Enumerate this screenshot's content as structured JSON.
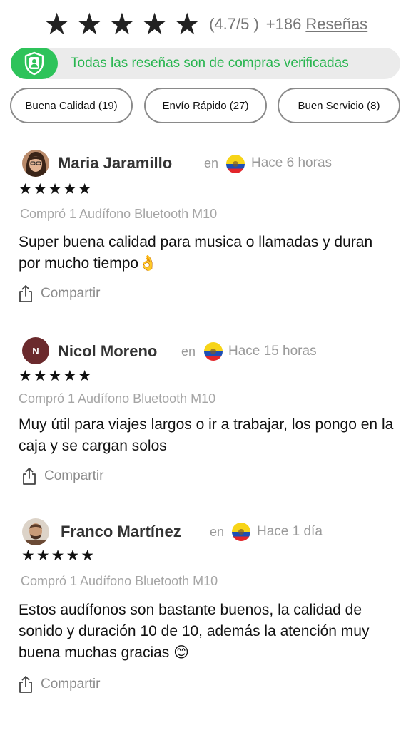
{
  "summary": {
    "stars": "★★★★★",
    "rating": "(4.7/5 )",
    "count": "+186",
    "reviews_link": "Reseñas"
  },
  "verified": {
    "icon": "shield-user-icon",
    "text": "Todas las reseñas son de compras verificadas",
    "color": "#28b54f"
  },
  "filters": [
    {
      "label": "Buena Calidad (19)"
    },
    {
      "label": "Envío Rápido (27)"
    },
    {
      "label": "Buen Servicio (8)"
    }
  ],
  "reviews": [
    {
      "name": "Maria Jaramillo",
      "en": "en",
      "time": "Hace 6 horas",
      "stars": "★★★★★",
      "purchase": "Compró 1 Audífono Bluetooth M10",
      "text": "Super buena calidad para musica o llamadas y duran por mucho tiempo👌",
      "share": "Compartir"
    },
    {
      "name": "Nicol Moreno",
      "initial": "N",
      "en": "en",
      "time": "Hace 15 horas",
      "stars": "★★★★★",
      "purchase": "Compró 1 Audífono Bluetooth M10",
      "text": "Muy útil para viajes largos o ir a trabajar, los pongo en la caja y se cargan solos",
      "share": "Compartir"
    },
    {
      "name": "Franco Martínez",
      "en": "en",
      "time": "Hace 1 día",
      "stars": "★★★★★",
      "purchase": "Compró 1 Audífono Bluetooth M10",
      "text": "Estos audífonos son bastante buenos, la calidad de sonido y duración 10 de 10,  además la atención muy buena muchas gracias 😊",
      "share": "Compartir"
    }
  ]
}
